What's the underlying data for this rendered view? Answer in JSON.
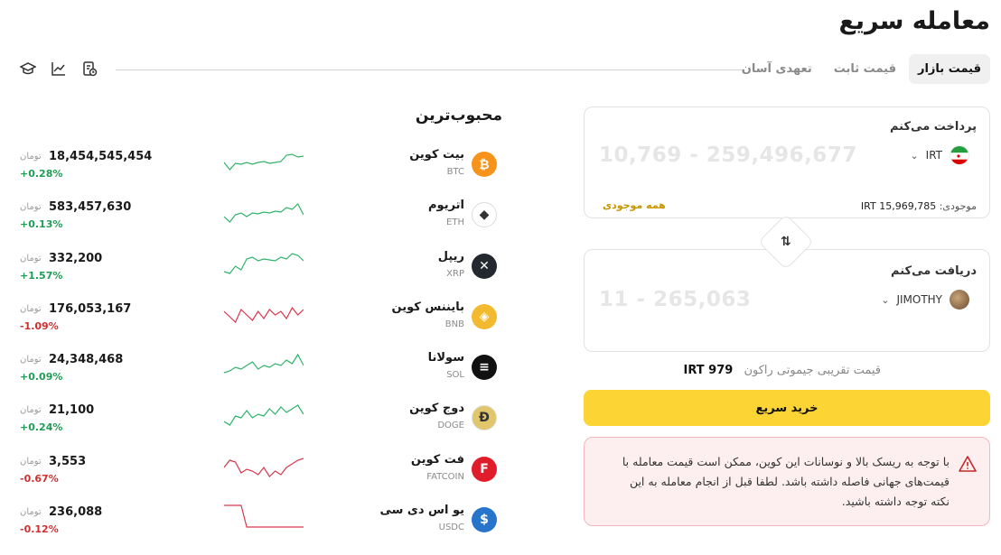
{
  "page": {
    "title": "معامله سریع"
  },
  "tabs": [
    {
      "label": "قیمت بازار",
      "active": true
    },
    {
      "label": "قیمت ثابت",
      "active": false
    },
    {
      "label": "تعهدی آسان",
      "active": false
    }
  ],
  "toolbar": {
    "icons": [
      "graduation-cap-icon",
      "line-chart-icon",
      "receipt-clock-icon"
    ]
  },
  "popular": {
    "title": "محبوب‌ترین",
    "unit": "تومان",
    "coins": [
      {
        "name": "بیت کوین",
        "symbol": "BTC",
        "price": "18,454,545,454",
        "change": "+0.28%",
        "trend": "up",
        "color": "#f7931a",
        "glyph": "₿",
        "spark": [
          18,
          26,
          19,
          20,
          18,
          20,
          18,
          17,
          19,
          18,
          17,
          10,
          9,
          12,
          11
        ]
      },
      {
        "name": "اتریوم",
        "symbol": "ETH",
        "price": "583,457,630",
        "change": "+0.13%",
        "trend": "up",
        "color": "#ffffff",
        "glyph": "◆",
        "spark": [
          22,
          28,
          20,
          18,
          22,
          18,
          19,
          17,
          18,
          16,
          17,
          12,
          14,
          8,
          20
        ]
      },
      {
        "name": "ریپل",
        "symbol": "XRP",
        "price": "332,200",
        "change": "+1.57%",
        "trend": "up",
        "color": "#23292f",
        "glyph": "✕",
        "spark": [
          26,
          28,
          20,
          24,
          12,
          10,
          14,
          12,
          13,
          14,
          10,
          12,
          6,
          8,
          14
        ]
      },
      {
        "name": "بایننس کوین",
        "symbol": "BNB",
        "price": "176,053,167",
        "change": "-1.09%",
        "trend": "down",
        "color": "#f3ba2f",
        "glyph": "◈",
        "spark": [
          14,
          20,
          26,
          12,
          18,
          24,
          14,
          22,
          12,
          18,
          14,
          22,
          10,
          18,
          12
        ]
      },
      {
        "name": "سولانا",
        "symbol": "SOL",
        "price": "24,348,468",
        "change": "+0.09%",
        "trend": "up",
        "color": "#111111",
        "glyph": "≡",
        "spark": [
          26,
          24,
          20,
          22,
          18,
          14,
          22,
          18,
          20,
          16,
          18,
          12,
          16,
          6,
          18
        ]
      },
      {
        "name": "دوج کوین",
        "symbol": "DOGE",
        "price": "21,100",
        "change": "+0.24%",
        "trend": "up",
        "color": "#e1c66b",
        "glyph": "Ð",
        "spark": [
          24,
          28,
          18,
          20,
          12,
          20,
          16,
          18,
          10,
          16,
          8,
          14,
          10,
          6,
          16
        ]
      },
      {
        "name": "فت کوین",
        "symbol": "FATCOIN",
        "price": "3,553",
        "change": "-0.67%",
        "trend": "down",
        "color": "#e01e2b",
        "glyph": "F",
        "spark": [
          18,
          10,
          12,
          24,
          20,
          22,
          26,
          18,
          28,
          22,
          26,
          18,
          14,
          10,
          8
        ]
      },
      {
        "name": "یو اس دی سی",
        "symbol": "USDC",
        "price": "236,088",
        "change": "-0.12%",
        "trend": "down",
        "color": "#2775ca",
        "glyph": "$",
        "spark": [
          4,
          4,
          4,
          4,
          28,
          28,
          28,
          28,
          28,
          28,
          28,
          28,
          28,
          28,
          28
        ]
      }
    ]
  },
  "pay": {
    "label": "پرداخت می‌کنم",
    "range": "10,769 - 259,496,677",
    "currency": "IRT",
    "flag_icon": "iran-flag-icon",
    "balance_label": "موجودی:",
    "balance_value": "15,969,785 IRT",
    "all_balance": "همه موجودی"
  },
  "swap_icon": "swap-arrows-icon",
  "receive": {
    "label": "دریافت می‌کنم",
    "range": "11 - 265,063",
    "currency": "JIMOTHY",
    "avatar_icon": "jimothy-token-icon"
  },
  "rate": {
    "label": "قیمت تقریبی جیموتی راکون",
    "value": "979 IRT"
  },
  "buy_button": "خرید سریع",
  "warning": {
    "icon": "warning-triangle-icon",
    "text": "با توجه به ریسک بالا و نوسانات این کوین، ممکن است قیمت معامله با قیمت‌های جهانی فاصله داشته باشد. لطفا قبل از انجام معامله به این نکته توجه داشته باشید."
  },
  "colors": {
    "accent": "#fcd535",
    "positive": "#1f9d55",
    "negative": "#d32f2f",
    "warning_bg": "#fdeef0"
  }
}
